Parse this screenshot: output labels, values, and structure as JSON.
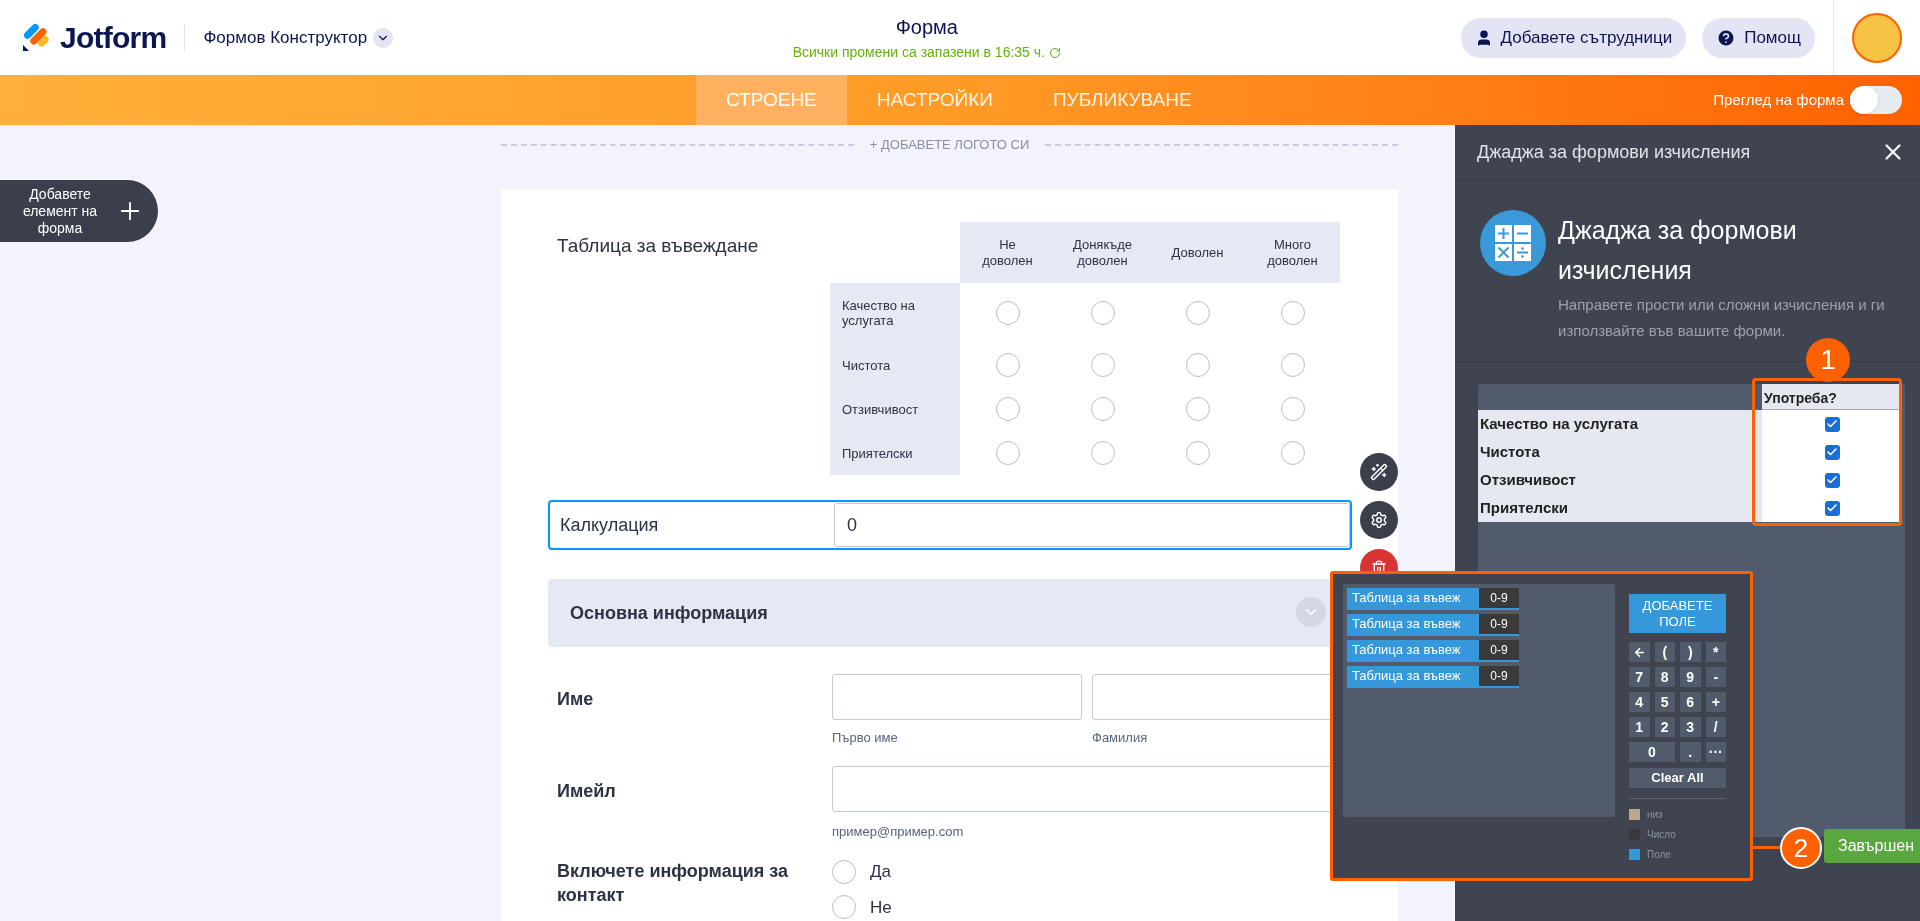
{
  "header": {
    "logo": "Jotform",
    "builder_menu": "Формов Конструктор",
    "form_title": "Форма",
    "save_status": "Всички промени са запазени в 16:35 ч.",
    "buttons": [
      {
        "label": "Добавете сътрудници",
        "kind": "user"
      },
      {
        "label": "Помощ",
        "kind": "help"
      }
    ]
  },
  "nav": {
    "tabs": [
      {
        "label": "СТРОЕНЕ",
        "selected": true
      },
      {
        "label": "НАСТРОЙКИ",
        "selected": false
      },
      {
        "label": "ПУБЛИКУВАНЕ",
        "selected": false
      }
    ],
    "preview": {
      "label": "Преглед на форма",
      "on": false
    }
  },
  "add_element": "Добавете елемент на форма",
  "add_logo": "+ ДОБАВЕТЕ ЛОГОТО СИ",
  "matrix": {
    "label": "Таблица за въвеждане",
    "columns": [
      "Не доволен",
      "Донякъде доволен",
      "Доволен",
      "Много доволен"
    ],
    "rows": [
      {
        "label": "Качество на услугата",
        "cells": [
          {
            "selected": false
          },
          {
            "selected": false
          },
          {
            "selected": false
          },
          {
            "selected": false
          }
        ]
      },
      {
        "label": "Чистота",
        "cells": [
          {
            "selected": false
          },
          {
            "selected": false
          },
          {
            "selected": false
          },
          {
            "selected": false
          }
        ]
      },
      {
        "label": "Отзивчивост",
        "cells": [
          {
            "selected": false
          },
          {
            "selected": false
          },
          {
            "selected": false
          },
          {
            "selected": false
          }
        ]
      },
      {
        "label": "Приятелски",
        "cells": [
          {
            "selected": false
          },
          {
            "selected": false
          },
          {
            "selected": false
          },
          {
            "selected": false
          }
        ]
      }
    ]
  },
  "calculation": {
    "label": "Калкулация",
    "value": "0"
  },
  "section": "Основна информация",
  "name_field": {
    "label": "Име",
    "sublabels": [
      "Първо име",
      "Фамилия"
    ]
  },
  "email_field": {
    "label": "Имейл",
    "sublabel": "пример@пример.com"
  },
  "contact_field": {
    "label": "Включете информация за контакт",
    "options": [
      {
        "label": "Да",
        "selected": false
      },
      {
        "label": "Не",
        "selected": false
      }
    ]
  },
  "panel": {
    "header": "Джаджа за формови изчисления",
    "title": "Джаджа за формови изчисления",
    "description": "Направете прости или сложни изчисления и ги използвайте във вашите форми.",
    "column": "Употреба?",
    "rows": [
      {
        "label": "Качество на услугата",
        "checked": true
      },
      {
        "label": "Чистота",
        "checked": true
      },
      {
        "label": "Отзивчивост",
        "checked": true
      },
      {
        "label": "Приятелски",
        "checked": true
      }
    ],
    "done": "Завършен"
  },
  "calculator": {
    "fields": [
      {
        "label": "Таблица за въвеж",
        "type": "0-9"
      },
      {
        "label": "Таблица за въвеж",
        "type": "0-9"
      },
      {
        "label": "Таблица за въвеж",
        "type": "0-9"
      },
      {
        "label": "Таблица за въвеж",
        "type": "0-9"
      }
    ],
    "add_field": "ДОБАВЕТЕ ПОЛЕ",
    "keys": [
      {
        "kind": "back"
      },
      {
        "kind": "key",
        "label": "("
      },
      {
        "kind": "key",
        "label": ")"
      },
      {
        "kind": "key",
        "label": "*"
      },
      {
        "kind": "key",
        "label": "7"
      },
      {
        "kind": "key",
        "label": "8"
      },
      {
        "kind": "key",
        "label": "9"
      },
      {
        "kind": "key",
        "label": "-"
      },
      {
        "kind": "key",
        "label": "4"
      },
      {
        "kind": "key",
        "label": "5"
      },
      {
        "kind": "key",
        "label": "6"
      },
      {
        "kind": "key",
        "label": "+"
      },
      {
        "kind": "key",
        "label": "1"
      },
      {
        "kind": "key",
        "label": "2"
      },
      {
        "kind": "key",
        "label": "3"
      },
      {
        "kind": "key",
        "label": "/"
      },
      {
        "kind": "wide",
        "label": "0"
      },
      {
        "kind": "key",
        "label": "."
      },
      {
        "kind": "key",
        "label": "···"
      }
    ],
    "clear": "Clear All",
    "legend": [
      {
        "label": "низ",
        "color": "#b9a88c"
      },
      {
        "label": "Число",
        "color": "#3a3a3a"
      },
      {
        "label": "Поле",
        "color": "#3498db"
      }
    ]
  },
  "callouts": [
    "1",
    "2"
  ]
}
